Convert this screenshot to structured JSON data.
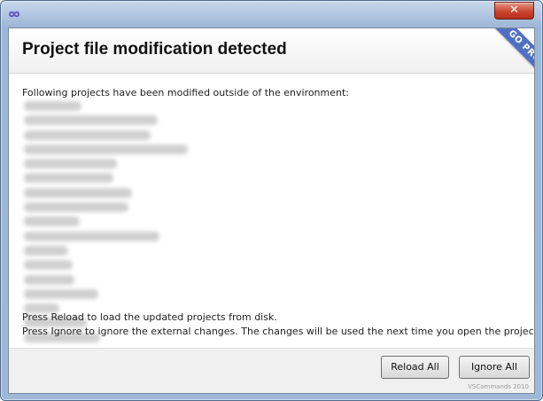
{
  "dialog": {
    "title": "Project file modification detected",
    "badge": "GO PRO",
    "close_label": "✕",
    "message": "Following projects have been modified outside of the environment:",
    "projects": [
      {
        "redacted": true,
        "approx_len": 0.31
      },
      {
        "redacted": true,
        "approx_len": 0.72
      },
      {
        "redacted": true,
        "approx_len": 0.68
      },
      {
        "redacted": true,
        "approx_len": 0.88
      },
      {
        "redacted": true,
        "approx_len": 0.5
      },
      {
        "redacted": true,
        "approx_len": 0.48
      },
      {
        "redacted": true,
        "approx_len": 0.58
      },
      {
        "redacted": true,
        "approx_len": 0.56
      },
      {
        "redacted": true,
        "approx_len": 0.3
      },
      {
        "redacted": true,
        "approx_len": 0.73
      },
      {
        "redacted": true,
        "approx_len": 0.24
      },
      {
        "redacted": true,
        "approx_len": 0.26
      },
      {
        "redacted": true,
        "approx_len": 0.27
      },
      {
        "redacted": true,
        "approx_len": 0.4
      },
      {
        "redacted": true,
        "approx_len": 0.19
      },
      {
        "redacted": true,
        "approx_len": 0.34
      },
      {
        "redacted": true,
        "approx_len": 0.41
      }
    ],
    "footer_line1": "Press Reload to load the updated projects from disk.",
    "footer_line2": "Press Ignore to ignore the external changes. The changes will be used the next time you open the projects.",
    "buttons": {
      "reload_all": "Reload All",
      "ignore_all": "Ignore All"
    },
    "watermark": "VSCommands 2010"
  },
  "colors": {
    "ribbon": "#4f6fc4",
    "close_button": "#c9452f",
    "window_frame": "#9fb8d8"
  },
  "icons": {
    "app": "vscommands-infinity-icon",
    "close": "close-icon"
  }
}
